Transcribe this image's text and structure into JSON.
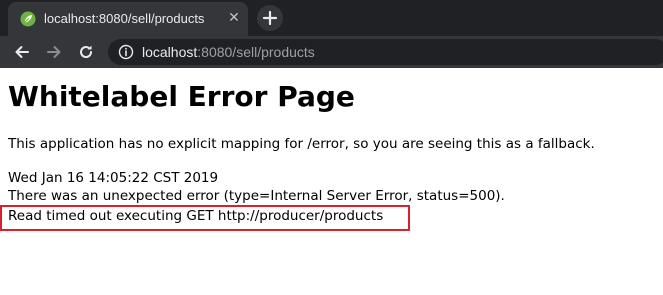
{
  "browser": {
    "tab": {
      "title": "localhost:8080/sell/products",
      "close_glyph": "✕"
    },
    "icons": {
      "favicon": "spring-leaf-icon",
      "new_tab": "plus-icon",
      "back": "arrow-left-icon",
      "forward": "arrow-right-icon",
      "reload": "reload-icon",
      "site_info": "info-icon"
    },
    "address_bar": {
      "host": "localhost",
      "path": ":8080/sell/products"
    },
    "colors": {
      "tabstrip": "#202124",
      "toolbar": "#35363a",
      "favicon": "#6db33f"
    }
  },
  "page": {
    "heading": "Whitelabel Error Page",
    "message": "This application has no explicit mapping for /error, so you are seeing this as a fallback.",
    "timestamp": "Wed Jan 16 14:05:22 CST 2019",
    "error_line": "There was an unexpected error (type=Internal Server Error, status=500).",
    "detail": "Read timed out executing GET http://producer/products",
    "highlight_color": "#d9202c"
  }
}
